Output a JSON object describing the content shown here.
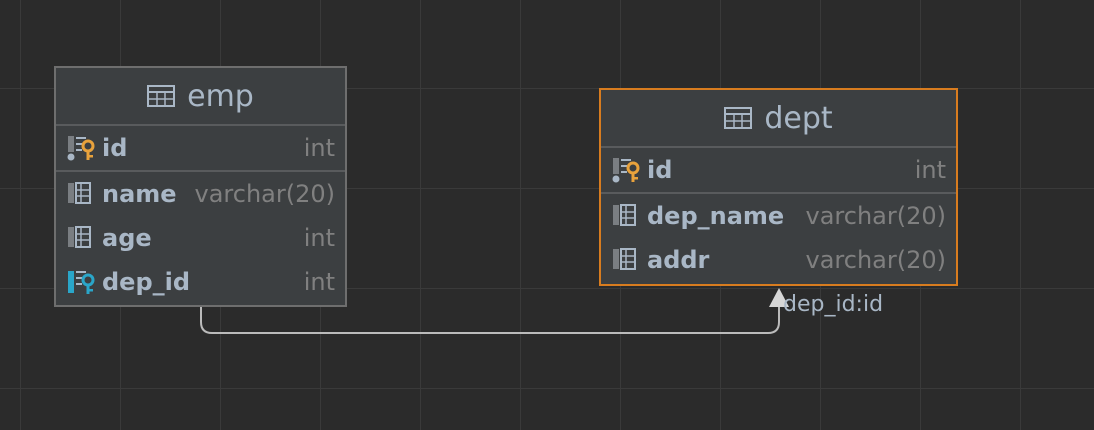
{
  "tables": {
    "emp": {
      "title": "emp",
      "columns": [
        {
          "name": "id",
          "type": "int",
          "icon": "primary-key-icon"
        },
        {
          "name": "name",
          "type": "varchar(20)",
          "icon": "column-icon"
        },
        {
          "name": "age",
          "type": "int",
          "icon": "column-icon"
        },
        {
          "name": "dep_id",
          "type": "int",
          "icon": "foreign-key-icon"
        }
      ]
    },
    "dept": {
      "title": "dept",
      "columns": [
        {
          "name": "id",
          "type": "int",
          "icon": "primary-key-icon"
        },
        {
          "name": "dep_name",
          "type": "varchar(20)",
          "icon": "column-icon"
        },
        {
          "name": "addr",
          "type": "varchar(20)",
          "icon": "column-icon"
        }
      ]
    }
  },
  "relation": {
    "label": "dep_id:id"
  },
  "colors": {
    "selected_border": "#d87c1f",
    "key_gold": "#e8a23c",
    "key_teal": "#2aa6c9"
  }
}
